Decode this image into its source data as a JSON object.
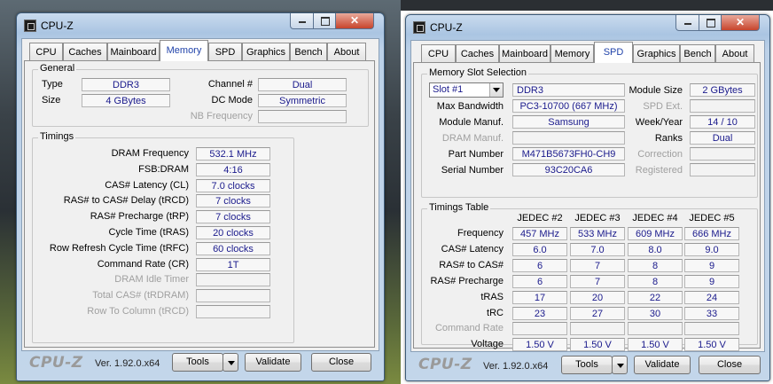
{
  "left_window": {
    "title": "CPU-Z",
    "tabs": [
      "CPU",
      "Caches",
      "Mainboard",
      "Memory",
      "SPD",
      "Graphics",
      "Bench",
      "About"
    ],
    "active_tab": "Memory",
    "general": {
      "title": "General",
      "type_label": "Type",
      "type_value": "DDR3",
      "size_label": "Size",
      "size_value": "4 GBytes",
      "channel_label": "Channel #",
      "channel_value": "Dual",
      "dcmode_label": "DC Mode",
      "dcmode_value": "Symmetric",
      "nbfreq_label": "NB Frequency",
      "nbfreq_value": ""
    },
    "timings": {
      "title": "Timings",
      "rows": [
        {
          "label": "DRAM Frequency",
          "value": "532.1 MHz",
          "disabled": false
        },
        {
          "label": "FSB:DRAM",
          "value": "4:16",
          "disabled": false
        },
        {
          "label": "CAS# Latency (CL)",
          "value": "7.0 clocks",
          "disabled": false
        },
        {
          "label": "RAS# to CAS# Delay (tRCD)",
          "value": "7 clocks",
          "disabled": false
        },
        {
          "label": "RAS# Precharge (tRP)",
          "value": "7 clocks",
          "disabled": false
        },
        {
          "label": "Cycle Time (tRAS)",
          "value": "20 clocks",
          "disabled": false
        },
        {
          "label": "Row Refresh Cycle Time (tRFC)",
          "value": "60 clocks",
          "disabled": false
        },
        {
          "label": "Command Rate (CR)",
          "value": "1T",
          "disabled": false
        },
        {
          "label": "DRAM Idle Timer",
          "value": "",
          "disabled": true
        },
        {
          "label": "Total CAS# (tRDRAM)",
          "value": "",
          "disabled": true
        },
        {
          "label": "Row To Column (tRCD)",
          "value": "",
          "disabled": true
        }
      ]
    },
    "footer": {
      "logo": "CPU-Z",
      "version": "Ver. 1.92.0.x64",
      "tools": "Tools",
      "validate": "Validate",
      "close": "Close"
    }
  },
  "right_window": {
    "title": "CPU-Z",
    "tabs": [
      "CPU",
      "Caches",
      "Mainboard",
      "Memory",
      "SPD",
      "Graphics",
      "Bench",
      "About"
    ],
    "active_tab": "SPD",
    "slot": {
      "title": "Memory Slot Selection",
      "slot_value": "Slot #1",
      "type_value": "DDR3",
      "module_size_label": "Module Size",
      "module_size_value": "2 GBytes",
      "max_bw_label": "Max Bandwidth",
      "max_bw_value": "PC3-10700 (667 MHz)",
      "spd_ext_label": "SPD Ext.",
      "spd_ext_value": "",
      "manuf_label": "Module Manuf.",
      "manuf_value": "Samsung",
      "week_label": "Week/Year",
      "week_value": "14 / 10",
      "dram_manuf_label": "DRAM Manuf.",
      "dram_manuf_value": "",
      "ranks_label": "Ranks",
      "ranks_value": "Dual",
      "part_label": "Part Number",
      "part_value": "M471B5673FH0-CH9",
      "correction_label": "Correction",
      "correction_value": "",
      "serial_label": "Serial Number",
      "serial_value": "93C20CA6",
      "registered_label": "Registered",
      "registered_value": ""
    },
    "timings_table": {
      "title": "Timings Table",
      "columns": [
        "JEDEC #2",
        "JEDEC #3",
        "JEDEC #4",
        "JEDEC #5"
      ],
      "rows": [
        {
          "label": "Frequency",
          "values": [
            "457 MHz",
            "533 MHz",
            "609 MHz",
            "666 MHz"
          ],
          "disabled": false
        },
        {
          "label": "CAS# Latency",
          "values": [
            "6.0",
            "7.0",
            "8.0",
            "9.0"
          ],
          "disabled": false
        },
        {
          "label": "RAS# to CAS#",
          "values": [
            "6",
            "7",
            "8",
            "9"
          ],
          "disabled": false
        },
        {
          "label": "RAS# Precharge",
          "values": [
            "6",
            "7",
            "8",
            "9"
          ],
          "disabled": false
        },
        {
          "label": "tRAS",
          "values": [
            "17",
            "20",
            "22",
            "24"
          ],
          "disabled": false
        },
        {
          "label": "tRC",
          "values": [
            "23",
            "27",
            "30",
            "33"
          ],
          "disabled": false
        },
        {
          "label": "Command Rate",
          "values": [
            "",
            "",
            "",
            ""
          ],
          "disabled": true
        },
        {
          "label": "Voltage",
          "values": [
            "1.50 V",
            "1.50 V",
            "1.50 V",
            "1.50 V"
          ],
          "disabled": false
        }
      ]
    },
    "footer": {
      "logo": "CPU-Z",
      "version": "Ver. 1.92.0.x64",
      "tools": "Tools",
      "validate": "Validate",
      "close": "Close"
    }
  },
  "colors": {
    "value_text": "#1a1a8c",
    "active_tab_text": "#2244aa",
    "close_button": "#c7442c"
  }
}
